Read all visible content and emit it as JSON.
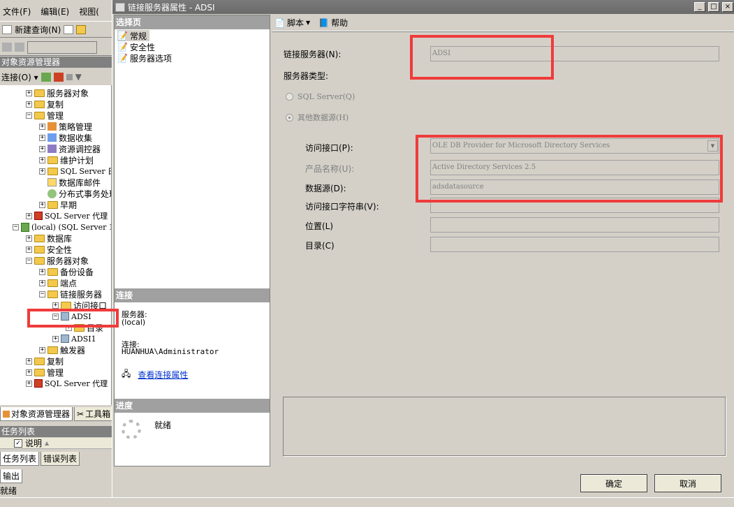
{
  "ssms": {
    "menu": [
      "文件(F)",
      "编辑(E)",
      "视图("
    ],
    "toolbar_new_query": "新建查询(N)",
    "object_explorer_title": "对象资源管理器",
    "connect_label": "连接(O) ▾",
    "tree": [
      {
        "label": "服务器对象",
        "level": 1,
        "expander": "+",
        "icon": "folder-icon"
      },
      {
        "label": "复制",
        "level": 1,
        "expander": "+",
        "icon": "folder-icon"
      },
      {
        "label": "管理",
        "level": 1,
        "expander": "−",
        "icon": "folder-icon"
      },
      {
        "label": "策略管理",
        "level": 2,
        "expander": "+",
        "icon": "policy-icon"
      },
      {
        "label": "数据收集",
        "level": 2,
        "expander": "+",
        "icon": "data-collection-icon"
      },
      {
        "label": "资源调控器",
        "level": 2,
        "expander": "+",
        "icon": "resource-governor-icon"
      },
      {
        "label": "维护计划",
        "level": 2,
        "expander": "+",
        "icon": "folder-icon"
      },
      {
        "label": "SQL Server 日志",
        "level": 2,
        "expander": "+",
        "icon": "folder-icon"
      },
      {
        "label": "数据库邮件",
        "level": 2,
        "expander": "",
        "icon": "mail-icon"
      },
      {
        "label": "分布式事务处理",
        "level": 2,
        "expander": "",
        "icon": "dtc-icon"
      },
      {
        "label": "早期",
        "level": 2,
        "expander": "+",
        "icon": "folder-icon"
      },
      {
        "label": "SQL Server 代理",
        "level": 1,
        "expander": "+",
        "icon": "agent-icon"
      },
      {
        "label": "(local) (SQL Server 1",
        "level": 0,
        "expander": "−",
        "icon": "server-icon"
      },
      {
        "label": "数据库",
        "level": 1,
        "expander": "+",
        "icon": "folder-icon"
      },
      {
        "label": "安全性",
        "level": 1,
        "expander": "+",
        "icon": "folder-icon"
      },
      {
        "label": "服务器对象",
        "level": 1,
        "expander": "−",
        "icon": "folder-icon"
      },
      {
        "label": "备份设备",
        "level": 2,
        "expander": "+",
        "icon": "folder-icon"
      },
      {
        "label": "端点",
        "level": 2,
        "expander": "+",
        "icon": "folder-icon"
      },
      {
        "label": "链接服务器",
        "level": 2,
        "expander": "−",
        "icon": "folder-icon"
      },
      {
        "label": "访问接口",
        "level": 3,
        "expander": "+",
        "icon": "folder-icon"
      },
      {
        "label": "ADSI",
        "level": 3,
        "expander": "−",
        "icon": "linked-server-icon"
      },
      {
        "label": "目录",
        "level": 4,
        "expander": "+",
        "icon": "folder-icon"
      },
      {
        "label": "ADSI1",
        "level": 3,
        "expander": "+",
        "icon": "linked-server-icon"
      },
      {
        "label": "触发器",
        "level": 2,
        "expander": "+",
        "icon": "folder-icon"
      },
      {
        "label": "复制",
        "level": 1,
        "expander": "+",
        "icon": "folder-icon"
      },
      {
        "label": "管理",
        "level": 1,
        "expander": "+",
        "icon": "folder-icon"
      },
      {
        "label": "SQL Server 代理",
        "level": 1,
        "expander": "+",
        "icon": "agent-icon"
      }
    ],
    "tabs_top": [
      "对象资源管理器",
      "工具箱"
    ],
    "task_list_title": "任务列表",
    "task_col": "说明",
    "tabs_bottom": [
      "任务列表",
      "错误列表"
    ],
    "output_tab": "输出",
    "status": "就绪"
  },
  "dialog": {
    "title": "链接服务器属性 - ADSI",
    "select_page_header": "选择页",
    "pages": [
      "常规",
      "安全性",
      "服务器选项"
    ],
    "connection_header": "连接",
    "server_label": "服务器:",
    "server_value": "(local)",
    "connection_label": "连接:",
    "connection_value": "HUANHUA\\Administrator",
    "view_link": "查看连接属性",
    "progress_header": "进度",
    "progress_status": "就绪",
    "toolbar": {
      "script": "脚本",
      "help": "帮助"
    },
    "fields": {
      "linked_server_label": "链接服务器(N):",
      "linked_server_value": "ADSI",
      "server_type_label": "服务器类型:",
      "sql_server_radio": "SQL Server(Q)",
      "other_source_radio": "其他数据源(H)",
      "provider_label": "访问接口(P):",
      "provider_value": "OLE DB Provider for Microsoft Directory Services",
      "product_label": "产品名称(U):",
      "product_value": "Active Directory Services 2.5",
      "datasource_label": "数据源(D):",
      "datasource_value": "adsdatasource",
      "provider_string_label": "访问接口字符串(V):",
      "provider_string_value": "",
      "location_label": "位置(L)",
      "location_value": "",
      "catalog_label": "目录(C)",
      "catalog_value": ""
    },
    "ok": "确定",
    "cancel": "取消",
    "window_buttons": [
      "_",
      "□",
      "×"
    ]
  },
  "colors": {
    "highlight": "#ef3b3b",
    "titlebar": "#707070",
    "link": "#0033cc"
  }
}
